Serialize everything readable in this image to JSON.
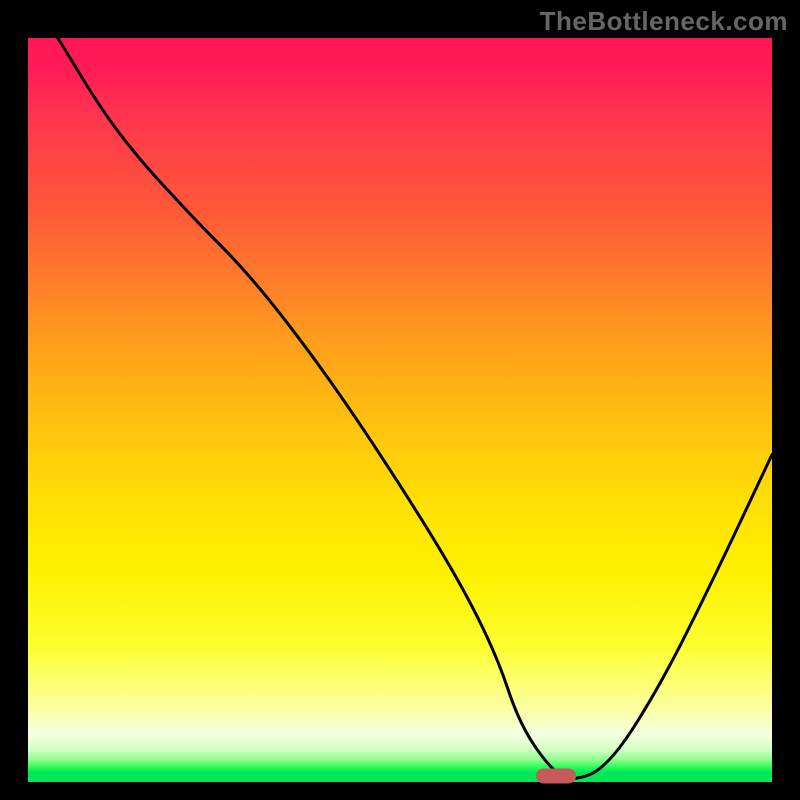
{
  "watermark": "TheBottleneck.com",
  "chart_data": {
    "type": "line",
    "title": "",
    "xlabel": "",
    "ylabel": "",
    "xlim": [
      0,
      100
    ],
    "ylim": [
      0,
      100
    ],
    "background": "red-to-green vertical gradient (bottleneck heatmap)",
    "series": [
      {
        "name": "bottleneck-curve",
        "x": [
          4,
          12,
          22,
          30,
          40,
          50,
          58,
          63,
          66,
          70,
          73,
          78,
          85,
          92,
          100
        ],
        "values": [
          100,
          87,
          76,
          68,
          55,
          40,
          27,
          17,
          8,
          2,
          0,
          2,
          13,
          27,
          44
        ]
      }
    ],
    "marker": {
      "x": 71,
      "y": 0.8,
      "color": "#c55a5a"
    },
    "grid": false,
    "legend": false
  }
}
